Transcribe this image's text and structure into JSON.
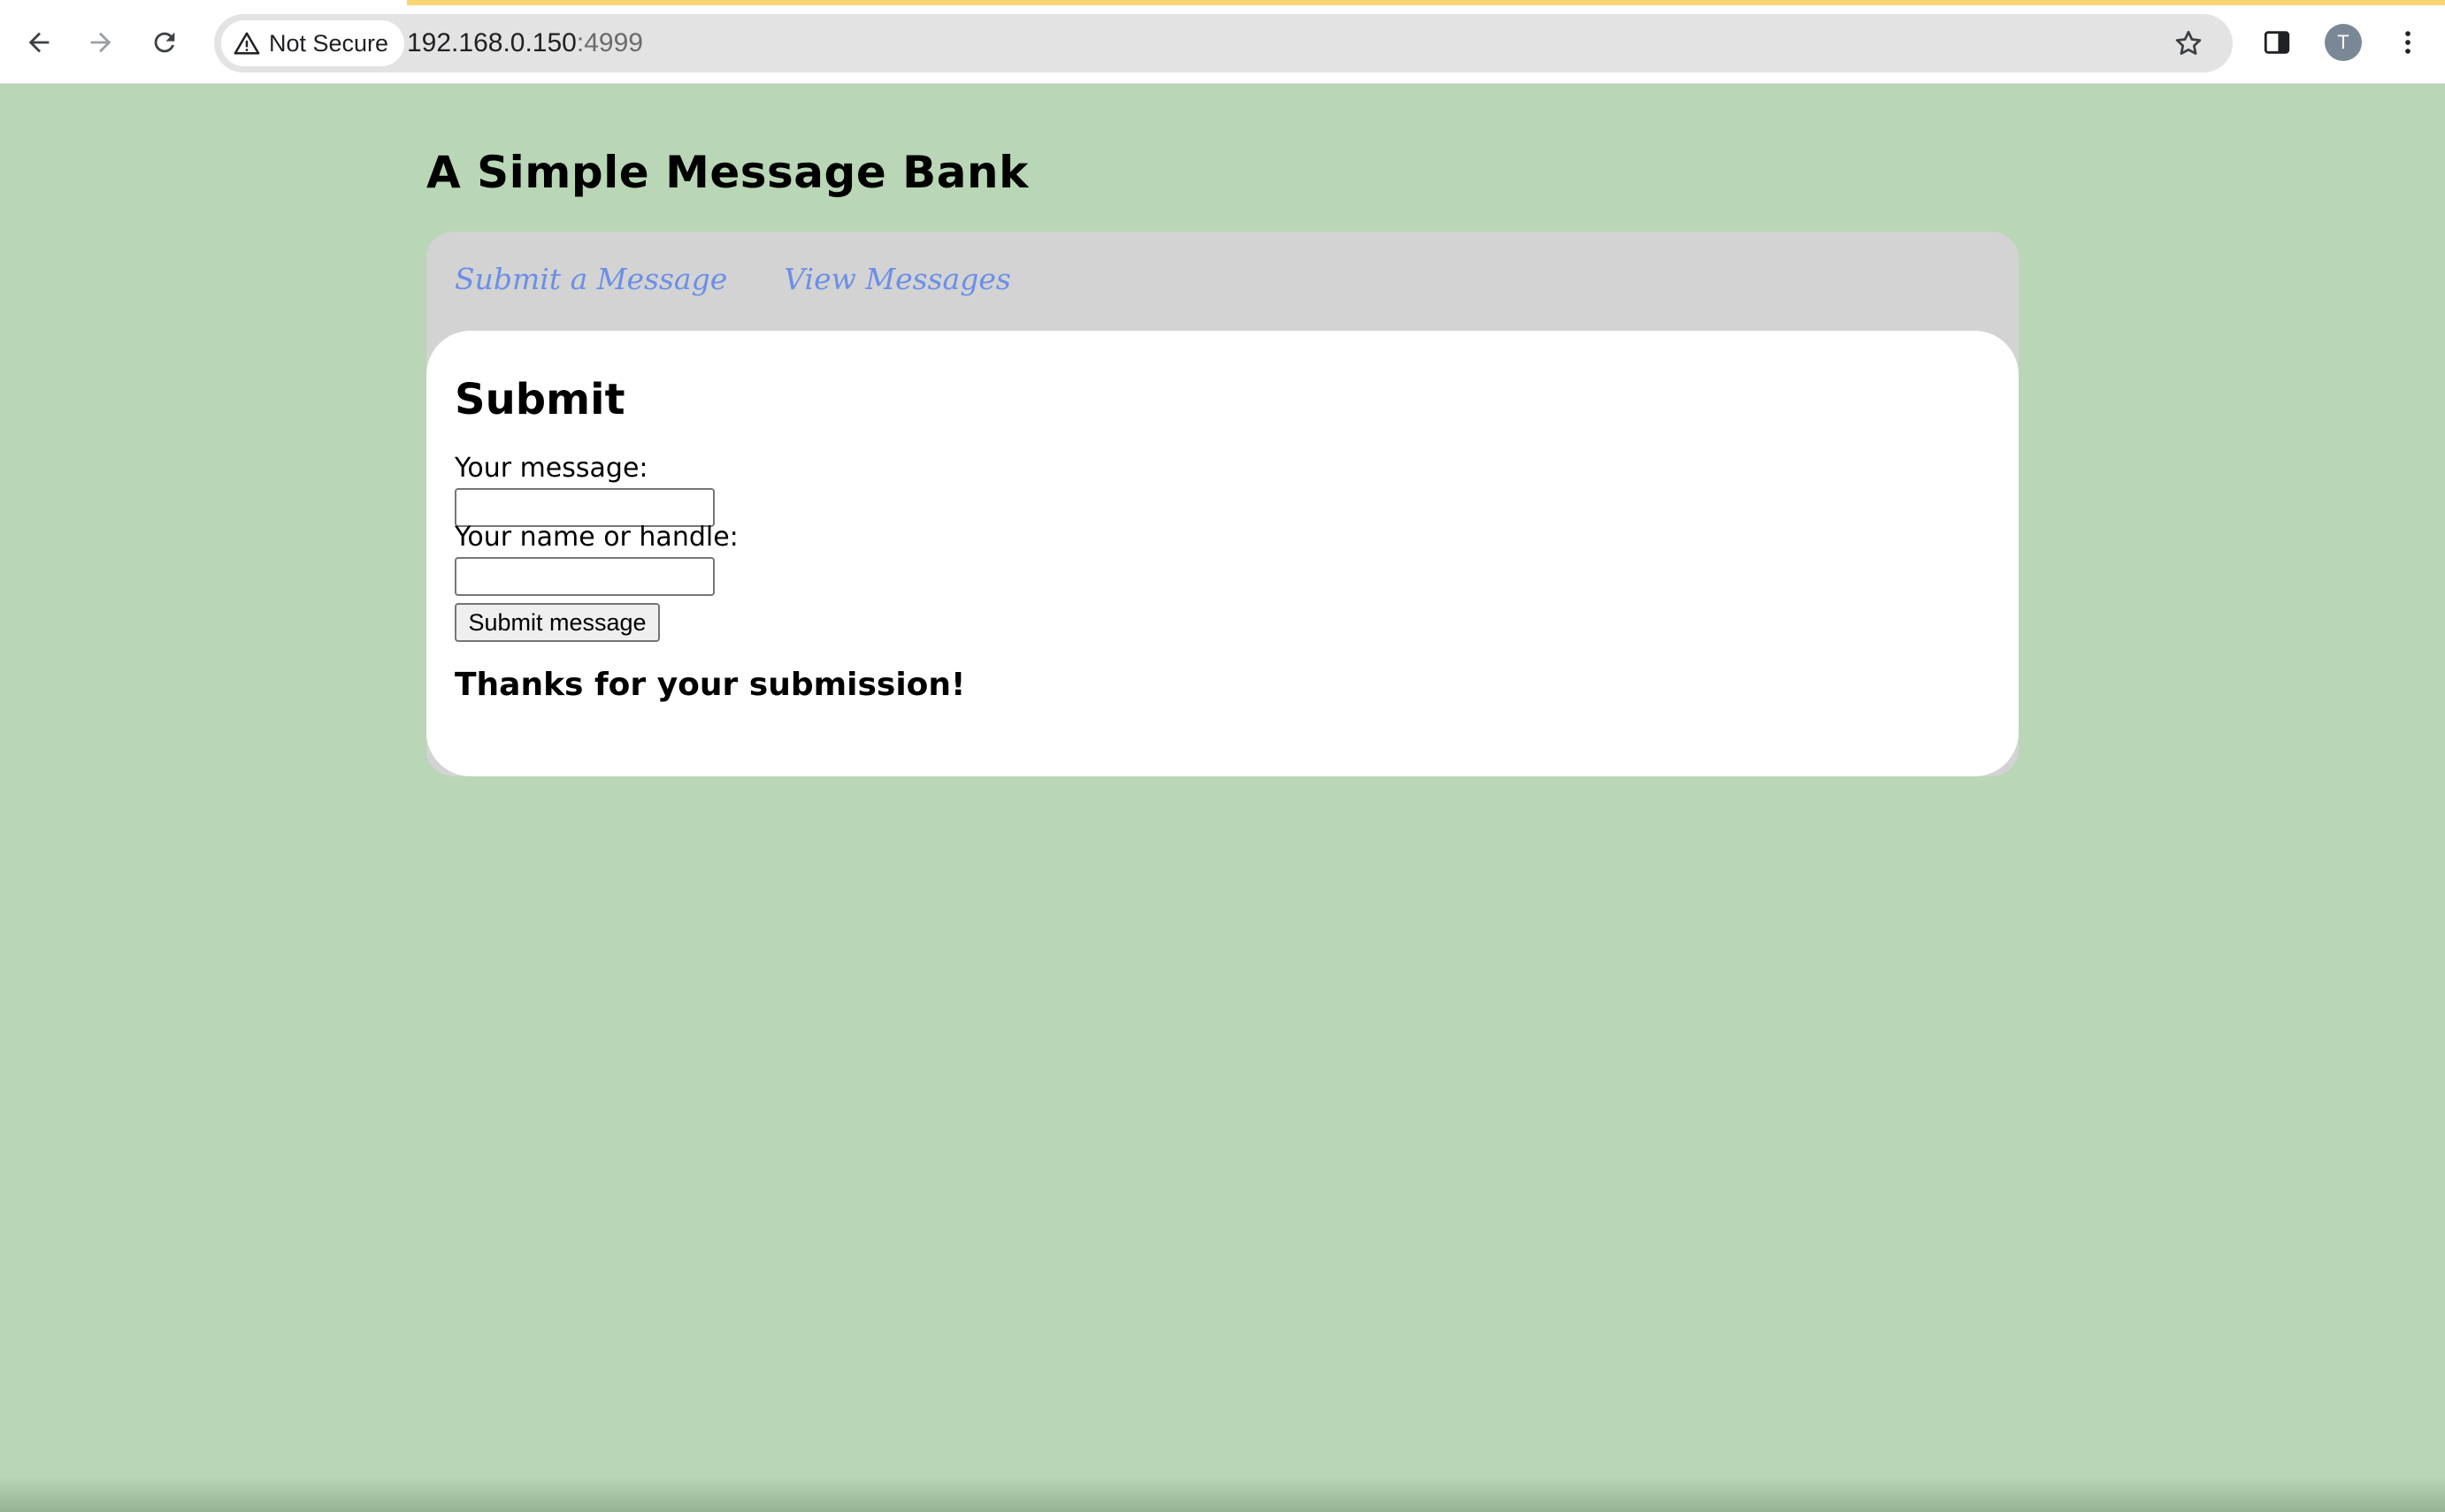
{
  "browser": {
    "security_label": "Not Secure",
    "url_host": "192.168.0.150",
    "url_port": ":4999",
    "profile_initial": "T",
    "icons": {
      "back": "back-arrow-icon",
      "forward": "forward-arrow-icon",
      "reload": "reload-icon",
      "warning": "warning-triangle-icon",
      "bookmark": "star-icon",
      "side_panel": "side-panel-icon",
      "menu": "kebab-menu-icon"
    },
    "colors": {
      "loading_bar": "#f7d774",
      "omnibox": "#e3e3e3"
    }
  },
  "page": {
    "title": "A Simple Message Bank",
    "nav": [
      {
        "label": "Submit a Message"
      },
      {
        "label": "View Messages"
      }
    ],
    "content": {
      "heading": "Submit",
      "message_label": "Your message:",
      "message_value": "",
      "name_label": "Your name or handle:",
      "name_value": "",
      "submit_label": "Submit message",
      "confirmation": "Thanks for your submission!"
    },
    "colors": {
      "background": "#b9d7b6",
      "panel": "#d3d3d3",
      "card": "#ffffff",
      "link": "#6b8fe8"
    }
  }
}
